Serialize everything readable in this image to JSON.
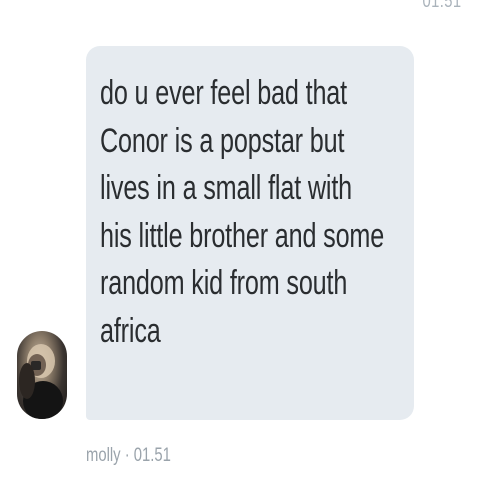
{
  "header": {
    "time": "01.51"
  },
  "message": {
    "text": "do u ever feel bad that\nConor is a popstar but\nlives in a small flat with\nhis little brother and some\nrandom kid from south\nafrica",
    "sender": "molly",
    "separator": "·",
    "timestamp": "01.51",
    "bubble_color": "#e6ebf0",
    "text_color": "#2a2d30",
    "avatar_icon": "user-avatar"
  }
}
